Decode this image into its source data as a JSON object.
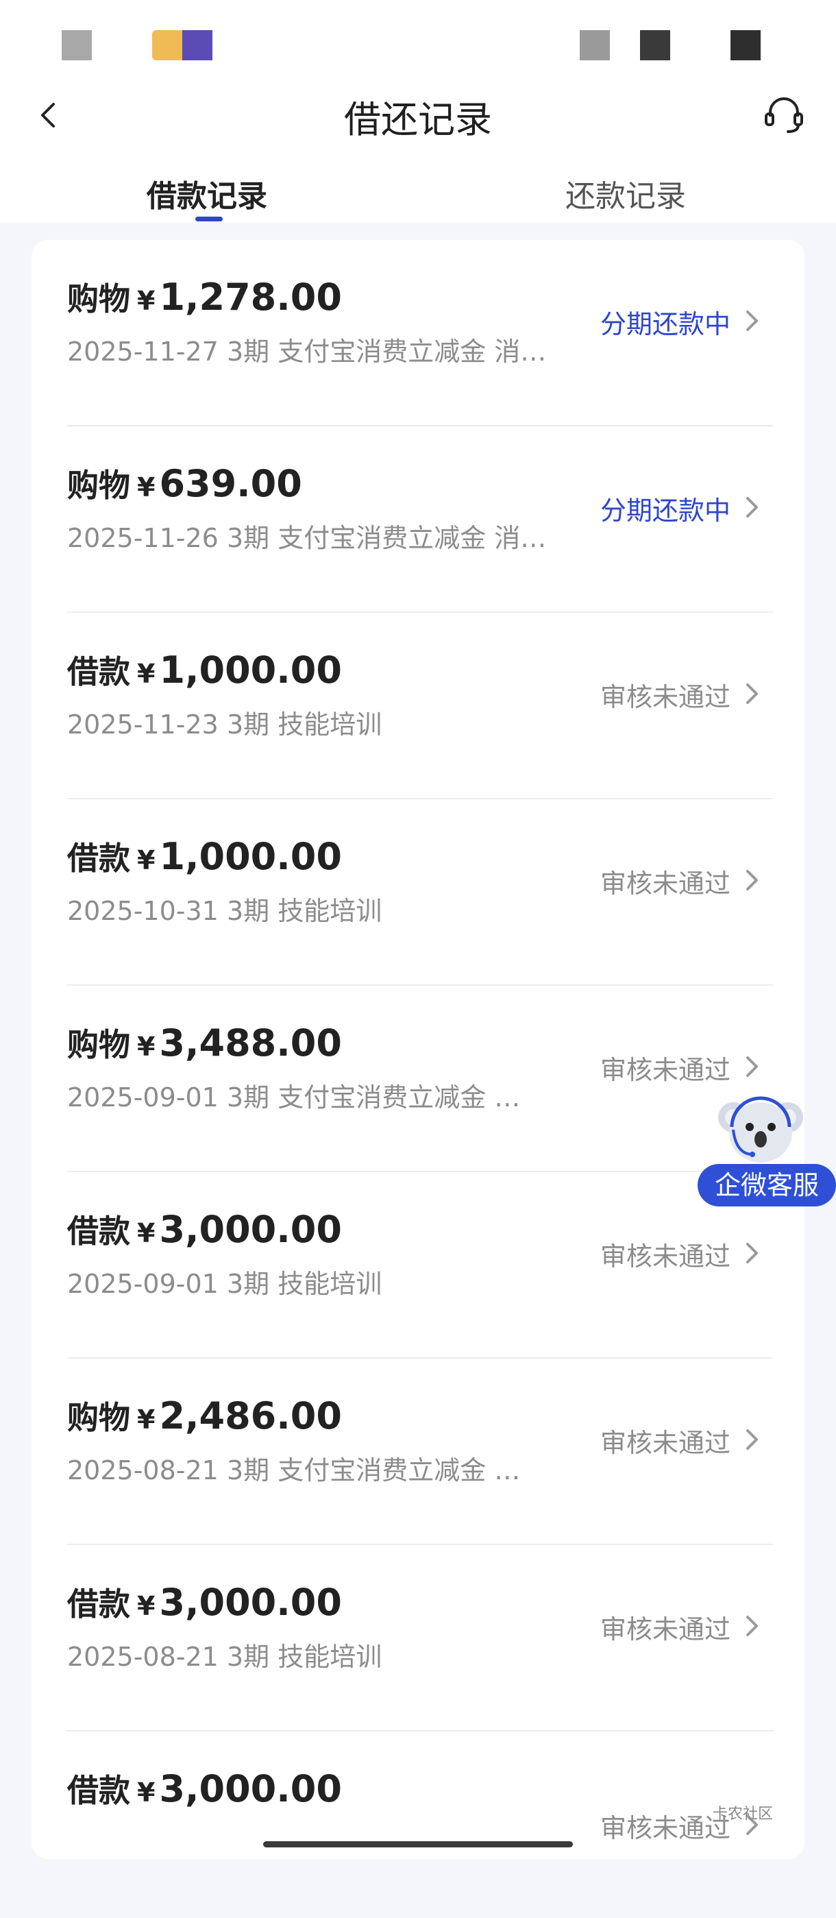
{
  "header": {
    "title": "借还记录"
  },
  "tabs": [
    {
      "label": "借款记录",
      "active": true
    },
    {
      "label": "还款记录",
      "active": false
    }
  ],
  "currency_symbol": "¥",
  "records": [
    {
      "type": "购物",
      "amount": "1,278.00",
      "date": "2025-11-27",
      "term": "3期",
      "desc": "支付宝消费立减金 消…",
      "status": "分期还款中",
      "status_color": "#2f46cc"
    },
    {
      "type": "购物",
      "amount": "639.00",
      "date": "2025-11-26",
      "term": "3期",
      "desc": "支付宝消费立减金 消…",
      "status": "分期还款中",
      "status_color": "#2f46cc"
    },
    {
      "type": "借款",
      "amount": "1,000.00",
      "date": "2025-11-23",
      "term": "3期",
      "desc": "技能培训",
      "status": "审核未通过",
      "status_color": "#8c8c8c"
    },
    {
      "type": "借款",
      "amount": "1,000.00",
      "date": "2025-10-31",
      "term": "3期",
      "desc": "技能培训",
      "status": "审核未通过",
      "status_color": "#8c8c8c"
    },
    {
      "type": "购物",
      "amount": "3,488.00",
      "date": "2025-09-01",
      "term": "3期",
      "desc": "支付宝消费立减金 …",
      "status": "审核未通过",
      "status_color": "#8c8c8c"
    },
    {
      "type": "借款",
      "amount": "3,000.00",
      "date": "2025-09-01",
      "term": "3期",
      "desc": "技能培训",
      "status": "审核未通过",
      "status_color": "#8c8c8c"
    },
    {
      "type": "购物",
      "amount": "2,486.00",
      "date": "2025-08-21",
      "term": "3期",
      "desc": "支付宝消费立减金 …",
      "status": "审核未通过",
      "status_color": "#8c8c8c"
    },
    {
      "type": "借款",
      "amount": "3,000.00",
      "date": "2025-08-21",
      "term": "3期",
      "desc": "技能培训",
      "status": "审核未通过",
      "status_color": "#8c8c8c"
    },
    {
      "type": "借款",
      "amount": "3,000.00",
      "date": "",
      "term": "",
      "desc": "",
      "status": "审核未通过",
      "status_color": "#8c8c8c"
    }
  ],
  "floating_service": {
    "label": "企微客服"
  },
  "watermark": {
    "text": "卡农社区"
  },
  "colors": {
    "accent": "#2f46cc",
    "muted": "#8c8c8c",
    "background": "#f4f6fb"
  },
  "icons": {
    "back": "chevron-left-icon",
    "support": "headset-icon",
    "row_arrow": "chevron-right-icon",
    "mascot": "koala-mascot-icon"
  }
}
